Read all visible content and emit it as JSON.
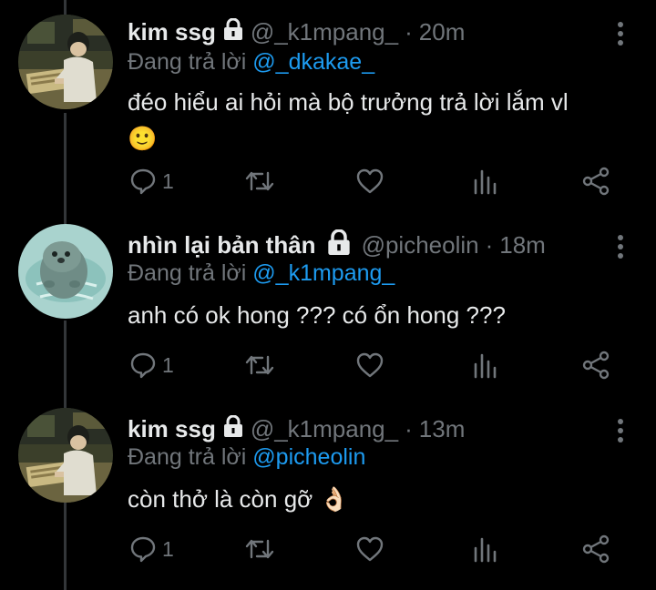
{
  "tweets": [
    {
      "name": "kim ssg",
      "handle": "@_k1mpang_",
      "separator": "·",
      "time": "20m",
      "reply_prefix": "Đang trả lời",
      "reply_handle": "@_dkakae_",
      "text_line1": "đéo hiểu ai hỏi mà bộ trưởng trả lời lắm vl",
      "text_line2": "🙂",
      "reply_count": "1",
      "avatar": "boy-reading-anime"
    },
    {
      "name": "nhìn lại bản thân",
      "handle": "@picheolin",
      "separator": "·",
      "time": "18m",
      "reply_prefix": "Đang trả lời",
      "reply_handle": "@_k1mpang_",
      "text_line1": "anh có ok hong ??? có ổn hong ???",
      "reply_count": "1",
      "avatar": "otter-in-water"
    },
    {
      "name": "kim ssg",
      "handle": "@_k1mpang_",
      "separator": "·",
      "time": "13m",
      "reply_prefix": "Đang trả lời",
      "reply_handle": "@picheolin",
      "text_line1": "còn thở là còn gỡ 👌🏻",
      "reply_count": "1",
      "avatar": "boy-reading-anime"
    }
  ],
  "icons": [
    "lock-icon",
    "more-icon",
    "reply-icon",
    "retweet-icon",
    "like-icon",
    "analytics-icon",
    "share-icon"
  ],
  "colors": {
    "background": "#000000",
    "text": "#e7e9ea",
    "secondary": "#71767b",
    "link": "#1d9bf0",
    "thread_line": "#333639"
  }
}
